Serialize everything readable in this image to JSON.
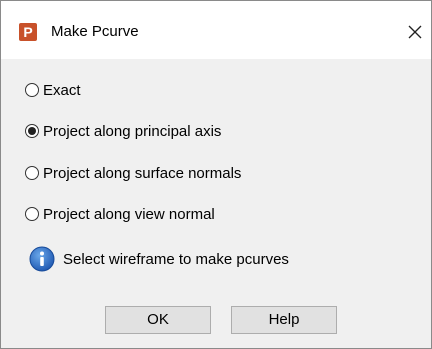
{
  "window": {
    "title": "Make Pcurve",
    "app_icon_letter": "P",
    "app_icon_color": "#c8512a"
  },
  "options": [
    {
      "label": "Exact",
      "checked": false
    },
    {
      "label": "Project along principal axis",
      "checked": true
    },
    {
      "label": "Project along surface normals",
      "checked": false
    },
    {
      "label": "Project along view normal",
      "checked": false
    }
  ],
  "info": {
    "icon": "info-icon",
    "message": "Select wireframe to make pcurves"
  },
  "buttons": {
    "ok_label": "OK",
    "help_label": "Help"
  }
}
